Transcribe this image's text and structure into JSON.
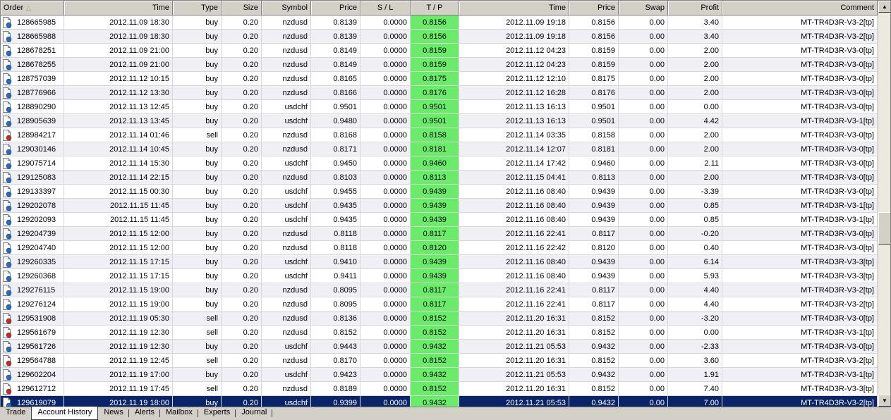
{
  "columns": [
    {
      "key": "order",
      "label": "Order",
      "w": 90,
      "align": "l"
    },
    {
      "key": "time",
      "label": "Time",
      "w": 154,
      "align": "r"
    },
    {
      "key": "type",
      "label": "Type",
      "w": 69,
      "align": "r"
    },
    {
      "key": "size",
      "label": "Size",
      "w": 57,
      "align": "r"
    },
    {
      "key": "symbol",
      "label": "Symbol",
      "w": 70,
      "align": "r"
    },
    {
      "key": "price",
      "label": "Price",
      "w": 70,
      "align": "r"
    },
    {
      "key": "sl",
      "label": "S / L",
      "w": 71,
      "align": "c"
    },
    {
      "key": "tp",
      "label": "T / P",
      "w": 69,
      "align": "c"
    },
    {
      "key": "ctime",
      "label": "Time",
      "w": 156,
      "align": "r"
    },
    {
      "key": "cprice",
      "label": "Price",
      "w": 70,
      "align": "r"
    },
    {
      "key": "swap",
      "label": "Swap",
      "w": 70,
      "align": "r"
    },
    {
      "key": "profit",
      "label": "Profit",
      "w": 77,
      "align": "r"
    },
    {
      "key": "comment",
      "label": "Comment",
      "w": 220,
      "align": "r"
    }
  ],
  "sort_indicator": "△",
  "colors": {
    "buy_icon": "#1f6fd0",
    "sell_icon": "#d02a1a",
    "tp_bg": "#6aec6a",
    "selected_bg": "#0a246a"
  },
  "rows": [
    {
      "order": "128665985",
      "time": "2012.11.09 18:30",
      "type": "buy",
      "size": "0.20",
      "symbol": "nzdusd",
      "price": "0.8139",
      "sl": "0.0000",
      "tp": "0.8156",
      "ctime": "2012.11.09 19:18",
      "cprice": "0.8156",
      "swap": "0.00",
      "profit": "3.40",
      "comment": "MT-TR4D3R-V3-2[tp]"
    },
    {
      "order": "128665988",
      "time": "2012.11.09 18:30",
      "type": "buy",
      "size": "0.20",
      "symbol": "nzdusd",
      "price": "0.8139",
      "sl": "0.0000",
      "tp": "0.8156",
      "ctime": "2012.11.09 19:18",
      "cprice": "0.8156",
      "swap": "0.00",
      "profit": "3.40",
      "comment": "MT-TR4D3R-V3-2[tp]"
    },
    {
      "order": "128678251",
      "time": "2012.11.09 21:00",
      "type": "buy",
      "size": "0.20",
      "symbol": "nzdusd",
      "price": "0.8149",
      "sl": "0.0000",
      "tp": "0.8159",
      "ctime": "2012.11.12 04:23",
      "cprice": "0.8159",
      "swap": "0.00",
      "profit": "2.00",
      "comment": "MT-TR4D3R-V3-0[tp]"
    },
    {
      "order": "128678255",
      "time": "2012.11.09 21:00",
      "type": "buy",
      "size": "0.20",
      "symbol": "nzdusd",
      "price": "0.8149",
      "sl": "0.0000",
      "tp": "0.8159",
      "ctime": "2012.11.12 04:23",
      "cprice": "0.8159",
      "swap": "0.00",
      "profit": "2.00",
      "comment": "MT-TR4D3R-V3-0[tp]"
    },
    {
      "order": "128757039",
      "time": "2012.11.12 10:15",
      "type": "buy",
      "size": "0.20",
      "symbol": "nzdusd",
      "price": "0.8165",
      "sl": "0.0000",
      "tp": "0.8175",
      "ctime": "2012.11.12 12:10",
      "cprice": "0.8175",
      "swap": "0.00",
      "profit": "2.00",
      "comment": "MT-TR4D3R-V3-0[tp]"
    },
    {
      "order": "128776966",
      "time": "2012.11.12 13:30",
      "type": "buy",
      "size": "0.20",
      "symbol": "nzdusd",
      "price": "0.8166",
      "sl": "0.0000",
      "tp": "0.8176",
      "ctime": "2012.11.12 16:28",
      "cprice": "0.8176",
      "swap": "0.00",
      "profit": "2.00",
      "comment": "MT-TR4D3R-V3-0[tp]"
    },
    {
      "order": "128890290",
      "time": "2012.11.13 12:45",
      "type": "buy",
      "size": "0.20",
      "symbol": "usdchf",
      "price": "0.9501",
      "sl": "0.0000",
      "tp": "0.9501",
      "ctime": "2012.11.13 16:13",
      "cprice": "0.9501",
      "swap": "0.00",
      "profit": "0.00",
      "comment": "MT-TR4D3R-V3-0[tp]"
    },
    {
      "order": "128905639",
      "time": "2012.11.13 13:45",
      "type": "buy",
      "size": "0.20",
      "symbol": "usdchf",
      "price": "0.9480",
      "sl": "0.0000",
      "tp": "0.9501",
      "ctime": "2012.11.13 16:13",
      "cprice": "0.9501",
      "swap": "0.00",
      "profit": "4.42",
      "comment": "MT-TR4D3R-V3-1[tp]"
    },
    {
      "order": "128984217",
      "time": "2012.11.14 01:46",
      "type": "sell",
      "size": "0.20",
      "symbol": "nzdusd",
      "price": "0.8168",
      "sl": "0.0000",
      "tp": "0.8158",
      "ctime": "2012.11.14 03:35",
      "cprice": "0.8158",
      "swap": "0.00",
      "profit": "2.00",
      "comment": "MT-TR4D3R-V3-0[tp]"
    },
    {
      "order": "129030146",
      "time": "2012.11.14 10:45",
      "type": "buy",
      "size": "0.20",
      "symbol": "nzdusd",
      "price": "0.8171",
      "sl": "0.0000",
      "tp": "0.8181",
      "ctime": "2012.11.14 12:07",
      "cprice": "0.8181",
      "swap": "0.00",
      "profit": "2.00",
      "comment": "MT-TR4D3R-V3-0[tp]"
    },
    {
      "order": "129075714",
      "time": "2012.11.14 15:30",
      "type": "buy",
      "size": "0.20",
      "symbol": "usdchf",
      "price": "0.9450",
      "sl": "0.0000",
      "tp": "0.9460",
      "ctime": "2012.11.14 17:42",
      "cprice": "0.9460",
      "swap": "0.00",
      "profit": "2.11",
      "comment": "MT-TR4D3R-V3-0[tp]"
    },
    {
      "order": "129125083",
      "time": "2012.11.14 22:15",
      "type": "buy",
      "size": "0.20",
      "symbol": "nzdusd",
      "price": "0.8103",
      "sl": "0.0000",
      "tp": "0.8113",
      "ctime": "2012.11.15 04:41",
      "cprice": "0.8113",
      "swap": "0.00",
      "profit": "2.00",
      "comment": "MT-TR4D3R-V3-0[tp]"
    },
    {
      "order": "129133397",
      "time": "2012.11.15 00:30",
      "type": "buy",
      "size": "0.20",
      "symbol": "usdchf",
      "price": "0.9455",
      "sl": "0.0000",
      "tp": "0.9439",
      "ctime": "2012.11.16 08:40",
      "cprice": "0.9439",
      "swap": "0.00",
      "profit": "-3.39",
      "comment": "MT-TR4D3R-V3-0[tp]"
    },
    {
      "order": "129202078",
      "time": "2012.11.15 11:45",
      "type": "buy",
      "size": "0.20",
      "symbol": "usdchf",
      "price": "0.9435",
      "sl": "0.0000",
      "tp": "0.9439",
      "ctime": "2012.11.16 08:40",
      "cprice": "0.9439",
      "swap": "0.00",
      "profit": "0.85",
      "comment": "MT-TR4D3R-V3-1[tp]"
    },
    {
      "order": "129202093",
      "time": "2012.11.15 11:45",
      "type": "buy",
      "size": "0.20",
      "symbol": "usdchf",
      "price": "0.9435",
      "sl": "0.0000",
      "tp": "0.9439",
      "ctime": "2012.11.16 08:40",
      "cprice": "0.9439",
      "swap": "0.00",
      "profit": "0.85",
      "comment": "MT-TR4D3R-V3-1[tp]"
    },
    {
      "order": "129204739",
      "time": "2012.11.15 12:00",
      "type": "buy",
      "size": "0.20",
      "symbol": "nzdusd",
      "price": "0.8118",
      "sl": "0.0000",
      "tp": "0.8117",
      "ctime": "2012.11.16 22:41",
      "cprice": "0.8117",
      "swap": "0.00",
      "profit": "-0.20",
      "comment": "MT-TR4D3R-V3-0[tp]"
    },
    {
      "order": "129204740",
      "time": "2012.11.15 12:00",
      "type": "buy",
      "size": "0.20",
      "symbol": "nzdusd",
      "price": "0.8118",
      "sl": "0.0000",
      "tp": "0.8120",
      "ctime": "2012.11.16 22:42",
      "cprice": "0.8120",
      "swap": "0.00",
      "profit": "0.40",
      "comment": "MT-TR4D3R-V3-0[tp]"
    },
    {
      "order": "129260335",
      "time": "2012.11.15 17:15",
      "type": "buy",
      "size": "0.20",
      "symbol": "usdchf",
      "price": "0.9410",
      "sl": "0.0000",
      "tp": "0.9439",
      "ctime": "2012.11.16 08:40",
      "cprice": "0.9439",
      "swap": "0.00",
      "profit": "6.14",
      "comment": "MT-TR4D3R-V3-3[tp]"
    },
    {
      "order": "129260368",
      "time": "2012.11.15 17:15",
      "type": "buy",
      "size": "0.20",
      "symbol": "usdchf",
      "price": "0.9411",
      "sl": "0.0000",
      "tp": "0.9439",
      "ctime": "2012.11.16 08:40",
      "cprice": "0.9439",
      "swap": "0.00",
      "profit": "5.93",
      "comment": "MT-TR4D3R-V3-3[tp]"
    },
    {
      "order": "129276115",
      "time": "2012.11.15 19:00",
      "type": "buy",
      "size": "0.20",
      "symbol": "nzdusd",
      "price": "0.8095",
      "sl": "0.0000",
      "tp": "0.8117",
      "ctime": "2012.11.16 22:41",
      "cprice": "0.8117",
      "swap": "0.00",
      "profit": "4.40",
      "comment": "MT-TR4D3R-V3-2[tp]"
    },
    {
      "order": "129276124",
      "time": "2012.11.15 19:00",
      "type": "buy",
      "size": "0.20",
      "symbol": "nzdusd",
      "price": "0.8095",
      "sl": "0.0000",
      "tp": "0.8117",
      "ctime": "2012.11.16 22:41",
      "cprice": "0.8117",
      "swap": "0.00",
      "profit": "4.40",
      "comment": "MT-TR4D3R-V3-2[tp]"
    },
    {
      "order": "129531908",
      "time": "2012.11.19 05:30",
      "type": "sell",
      "size": "0.20",
      "symbol": "nzdusd",
      "price": "0.8136",
      "sl": "0.0000",
      "tp": "0.8152",
      "ctime": "2012.11.20 16:31",
      "cprice": "0.8152",
      "swap": "0.00",
      "profit": "-3.20",
      "comment": "MT-TR4D3R-V3-0[tp]"
    },
    {
      "order": "129561679",
      "time": "2012.11.19 12:30",
      "type": "sell",
      "size": "0.20",
      "symbol": "nzdusd",
      "price": "0.8152",
      "sl": "0.0000",
      "tp": "0.8152",
      "ctime": "2012.11.20 16:31",
      "cprice": "0.8152",
      "swap": "0.00",
      "profit": "0.00",
      "comment": "MT-TR4D3R-V3-1[tp]"
    },
    {
      "order": "129561726",
      "time": "2012.11.19 12:30",
      "type": "buy",
      "size": "0.20",
      "symbol": "usdchf",
      "price": "0.9443",
      "sl": "0.0000",
      "tp": "0.9432",
      "ctime": "2012.11.21 05:53",
      "cprice": "0.9432",
      "swap": "0.00",
      "profit": "-2.33",
      "comment": "MT-TR4D3R-V3-0[tp]"
    },
    {
      "order": "129564788",
      "time": "2012.11.19 12:45",
      "type": "sell",
      "size": "0.20",
      "symbol": "nzdusd",
      "price": "0.8170",
      "sl": "0.0000",
      "tp": "0.8152",
      "ctime": "2012.11.20 16:31",
      "cprice": "0.8152",
      "swap": "0.00",
      "profit": "3.60",
      "comment": "MT-TR4D3R-V3-2[tp]"
    },
    {
      "order": "129602204",
      "time": "2012.11.19 17:00",
      "type": "buy",
      "size": "0.20",
      "symbol": "usdchf",
      "price": "0.9423",
      "sl": "0.0000",
      "tp": "0.9432",
      "ctime": "2012.11.21 05:53",
      "cprice": "0.9432",
      "swap": "0.00",
      "profit": "1.91",
      "comment": "MT-TR4D3R-V3-1[tp]"
    },
    {
      "order": "129612712",
      "time": "2012.11.19 17:45",
      "type": "sell",
      "size": "0.20",
      "symbol": "nzdusd",
      "price": "0.8189",
      "sl": "0.0000",
      "tp": "0.8152",
      "ctime": "2012.11.20 16:31",
      "cprice": "0.8152",
      "swap": "0.00",
      "profit": "7.40",
      "comment": "MT-TR4D3R-V3-3[tp]"
    },
    {
      "order": "129619079",
      "time": "2012.11.19 18:00",
      "type": "buy",
      "size": "0.20",
      "symbol": "usdchf",
      "price": "0.9399",
      "sl": "0.0000",
      "tp": "0.9432",
      "ctime": "2012.11.21 05:53",
      "cprice": "0.9432",
      "swap": "0.00",
      "profit": "7.00",
      "comment": "MT-TR4D3R-V3-2[tp]",
      "selected": true
    }
  ],
  "scrollbar": {
    "up_icon": "▲",
    "down_icon": "▼",
    "position": 0.57
  },
  "tabs": [
    {
      "label": "Trade",
      "active": false
    },
    {
      "label": "Account History",
      "active": true
    },
    {
      "label": "News",
      "active": false
    },
    {
      "label": "Alerts",
      "active": false
    },
    {
      "label": "Mailbox",
      "active": false
    },
    {
      "label": "Experts",
      "active": false
    },
    {
      "label": "Journal",
      "active": false
    }
  ]
}
